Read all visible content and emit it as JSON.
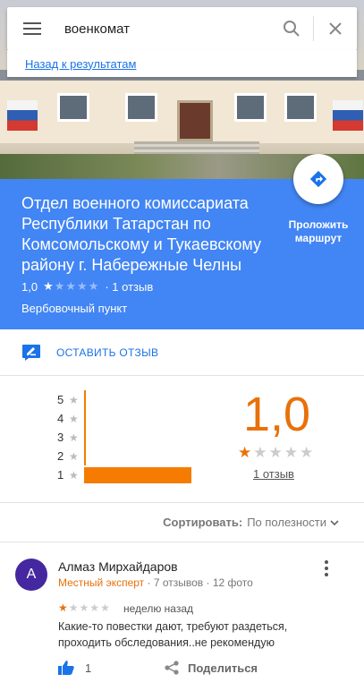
{
  "search": {
    "query": "военкомат",
    "back_link": "Назад к результатам"
  },
  "place": {
    "title": "Отдел военного комиссариата Республики Татарстан по Комсомольскому и Тукаевскому району г. Набережные Челны",
    "rating": "1,0",
    "rating_value": 1.0,
    "stars": "★★★★★",
    "reviews_count": "· 1 отзыв",
    "category": "Вербовочный пункт",
    "route_label": "Проложить маршрут"
  },
  "actions": {
    "write_review": "ОСТАВИТЬ ОТЗЫВ"
  },
  "histogram": {
    "rows": [
      {
        "stars": "5",
        "count": 0
      },
      {
        "stars": "4",
        "count": 0
      },
      {
        "stars": "3",
        "count": 0
      },
      {
        "stars": "2",
        "count": 0
      },
      {
        "stars": "1",
        "count": 1
      }
    ],
    "summary_rating": "1,0",
    "summary_count": "1 отзыв"
  },
  "sort": {
    "label": "Сортировать:",
    "value": "По полезности"
  },
  "review": {
    "avatar_letter": "А",
    "author": "Алмаз Мирхайдаров",
    "badge": "Местный эксперт",
    "meta": " · 7 отзывов · 12 фото",
    "rating_value": 1,
    "time": "неделю назад",
    "text": "Какие-то повестки дают, требуют раздеться, проходить обследования..не рекомендую",
    "likes": "1",
    "share_label": "Поделиться"
  },
  "colors": {
    "primary": "#4285f4",
    "accent": "#e8710a",
    "link": "#1a73e8",
    "avatar": "#4527a0"
  }
}
